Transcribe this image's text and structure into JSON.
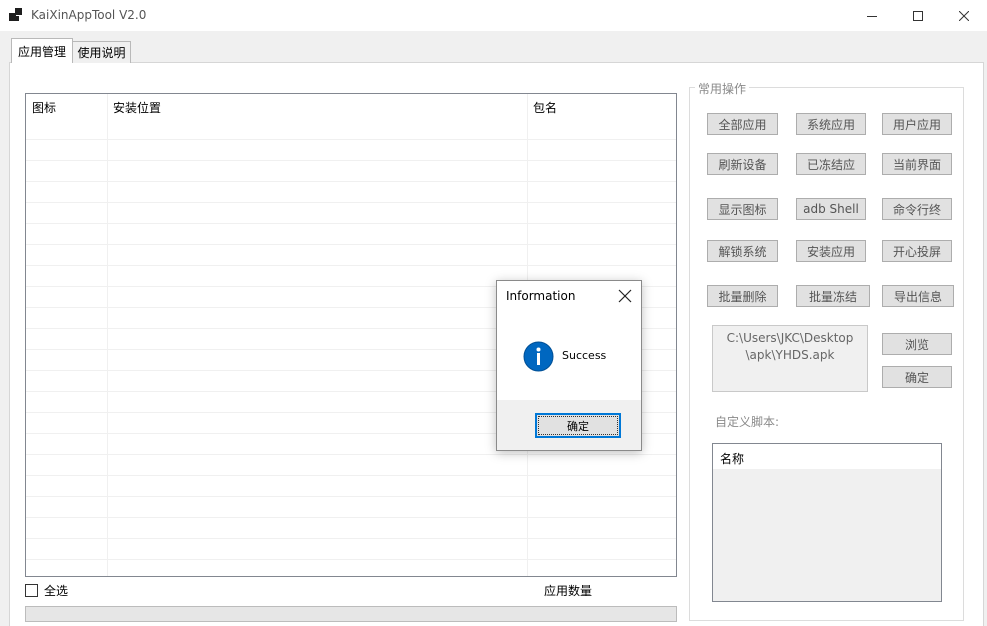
{
  "window": {
    "title": "KaiXinAppTool V2.0"
  },
  "tabs": [
    {
      "label": "应用管理",
      "active": true
    },
    {
      "label": "使用说明",
      "active": false
    }
  ],
  "app_list": {
    "columns": [
      "图标",
      "安装位置",
      "包名"
    ],
    "rows": []
  },
  "select_all_label": "全选",
  "app_count_label": "应用数量",
  "progress": 0,
  "common_ops": {
    "legend": "常用操作",
    "buttons": [
      [
        "全部应用",
        "系统应用",
        "用户应用"
      ],
      [
        "刷新设备",
        "已冻结应",
        "当前界面"
      ],
      [
        "显示图标",
        "adb Shell",
        "命令行终"
      ],
      [
        "解锁系统",
        "安装应用",
        "开心投屏"
      ],
      [
        "批量删除",
        "批量冻结",
        "导出信息"
      ]
    ],
    "path_line1": "C:\\Users\\JKC\\Desktop",
    "path_line2": "\\apk\\YHDS.apk",
    "browse_label": "浏览",
    "confirm_label": "确定",
    "custom_script_label": "自定义脚本:",
    "script_column": "名称"
  },
  "dialog": {
    "title": "Information",
    "message": "Success",
    "ok_label": "确定",
    "icon": "information-icon",
    "icon_color": "#0067c0"
  }
}
